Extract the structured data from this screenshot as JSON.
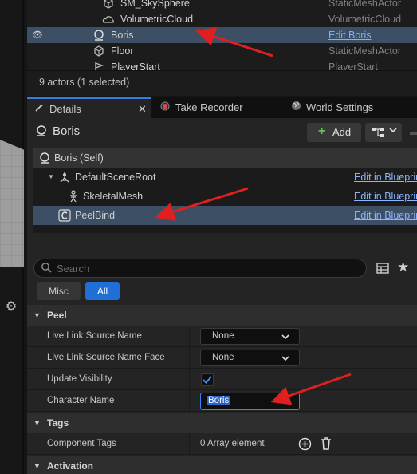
{
  "outliner": {
    "rows": [
      {
        "name": "SM_SkySphere",
        "type": "StaticMeshActor"
      },
      {
        "name": "VolumetricCloud",
        "type": "VolumetricCloud"
      },
      {
        "name": "Boris",
        "type": "Edit Boris"
      },
      {
        "name": "Floor",
        "type": "StaticMeshActor"
      },
      {
        "name": "PlayerStart",
        "type": "PlayerStart"
      }
    ],
    "status": "9 actors (1 selected)"
  },
  "tabs": [
    {
      "label": "Details",
      "icon": "details-icon"
    },
    {
      "label": "Take Recorder",
      "icon": "record-icon"
    },
    {
      "label": "World Settings",
      "icon": "globe-icon"
    }
  ],
  "details": {
    "actor_name": "Boris",
    "add_label": "Add",
    "components": [
      {
        "label": "Boris (Self)",
        "link": ""
      },
      {
        "label": "DefaultSceneRoot",
        "link": "Edit in Blueprint"
      },
      {
        "label": "SkeletalMesh",
        "link": "Edit in Blueprint"
      },
      {
        "label": "PeelBind",
        "link": "Edit in Blueprint"
      }
    ],
    "search_placeholder": "Search",
    "filters": {
      "misc": "Misc",
      "all": "All"
    },
    "sections": {
      "peel": "Peel",
      "tags": "Tags",
      "activation": "Activation"
    },
    "props": {
      "live_link_source_name": {
        "label": "Live Link Source Name",
        "value": "None"
      },
      "live_link_source_name_face": {
        "label": "Live Link Source Name Face",
        "value": "None"
      },
      "update_visibility": {
        "label": "Update Visibility",
        "checked": true
      },
      "character_name": {
        "label": "Character Name",
        "value": "Boris"
      },
      "component_tags": {
        "label": "Component Tags",
        "value": "0 Array element"
      }
    }
  },
  "colors": {
    "accent": "#1f6fd6",
    "selection": "#3d4f64",
    "annotation_arrow": "#e02020"
  }
}
